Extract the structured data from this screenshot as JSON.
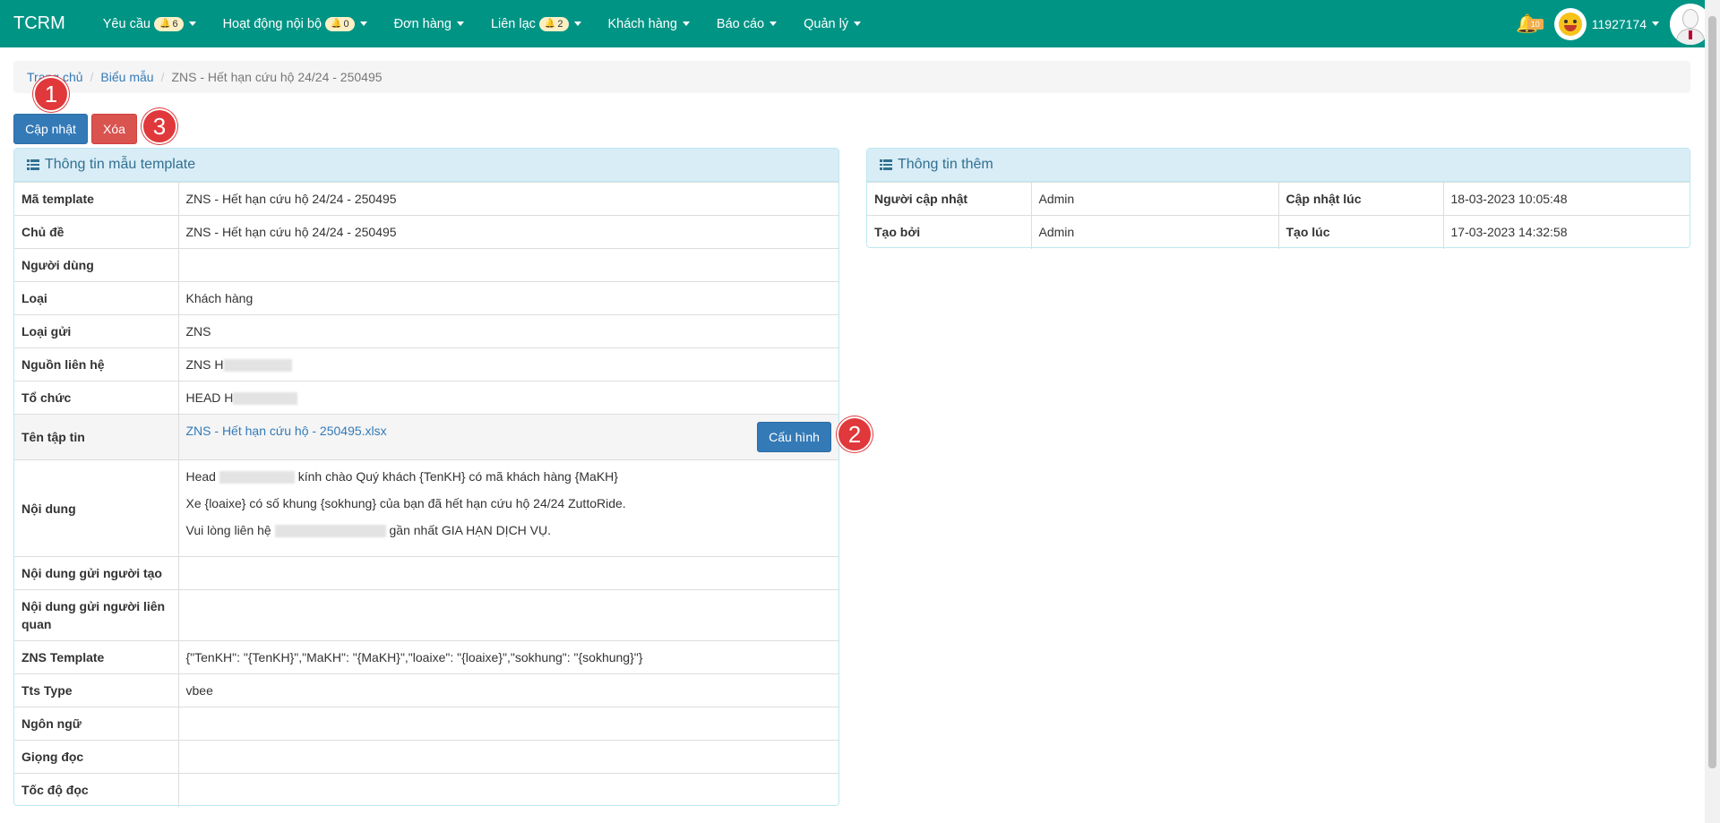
{
  "navbar": {
    "brand": "TCRM",
    "items": [
      {
        "label": "Yêu cầu",
        "badge": "6"
      },
      {
        "label": "Hoạt động nội bộ",
        "badge": "0"
      },
      {
        "label": "Đơn hàng"
      },
      {
        "label": "Liên lạc",
        "badge": "2"
      },
      {
        "label": "Khách hàng"
      },
      {
        "label": "Báo cáo"
      },
      {
        "label": "Quản lý"
      }
    ],
    "notification_count": "10",
    "user_name": "11927174"
  },
  "breadcrumb": {
    "home": "Trang chủ",
    "section": "Biểu mẫu",
    "current": "ZNS - Hết hạn cứu hộ 24/24 - 250495"
  },
  "actions": {
    "update": "Cập nhật",
    "delete": "Xóa",
    "configure": "Cấu hình"
  },
  "markers": [
    "1",
    "2",
    "3"
  ],
  "template_panel": {
    "title": "Thông tin mẫu template",
    "rows": [
      {
        "label": "Mã template",
        "value": "ZNS - Hết hạn cứu hộ 24/24 - 250495"
      },
      {
        "label": "Chủ đề",
        "value": "ZNS - Hết hạn cứu hộ 24/24 - 250495"
      },
      {
        "label": "Người dùng",
        "value": ""
      },
      {
        "label": "Loại",
        "value": "Khách hàng"
      },
      {
        "label": "Loại gửi",
        "value": "ZNS"
      },
      {
        "label": "Nguồn liên hệ",
        "value": "ZNS H"
      },
      {
        "label": "Tổ chức",
        "value": "HEAD H"
      },
      {
        "label": "Tên tập tin",
        "value": "ZNS - Hết hạn cứu hộ - 250495.xlsx"
      },
      {
        "label": "Nội dung",
        "value": ""
      },
      {
        "label": "Nội dung gửi người tạo",
        "value": ""
      },
      {
        "label": "Nội dung gửi người liên quan",
        "value": ""
      },
      {
        "label": "ZNS Template",
        "value": "{\"TenKH\": \"{TenKH}\",\"MaKH\": \"{MaKH}\",\"loaixe\": \"{loaixe}\",\"sokhung\": \"{sokhung}\"}"
      },
      {
        "label": "Tts Type",
        "value": "vbee"
      },
      {
        "label": "Ngôn ngữ",
        "value": ""
      },
      {
        "label": "Giọng đọc",
        "value": ""
      },
      {
        "label": "Tốc độ đọc",
        "value": ""
      }
    ],
    "content_lines": [
      {
        "before": "Head",
        "after": "kính chào Quý khách {TenKH} có mã khách hàng {MaKH}"
      },
      {
        "before": "Xe {loaixe} có số khung {sokhung} của bạn đã hết hạn cứu hộ 24/24 ZuttoRide.",
        "after": ""
      },
      {
        "before": "Vui lòng liên hệ",
        "after": "gần nhất GIA HẠN DỊCH VỤ."
      }
    ]
  },
  "extra_panel": {
    "title": "Thông tin thêm",
    "rows": [
      {
        "label1": "Người cập nhật",
        "value1": "Admin",
        "label2": "Cập nhật lúc",
        "value2": "18-03-2023 10:05:48"
      },
      {
        "label1": "Tạo bởi",
        "value1": "Admin",
        "label2": "Tạo lúc",
        "value2": "17-03-2023 14:32:58"
      }
    ]
  }
}
